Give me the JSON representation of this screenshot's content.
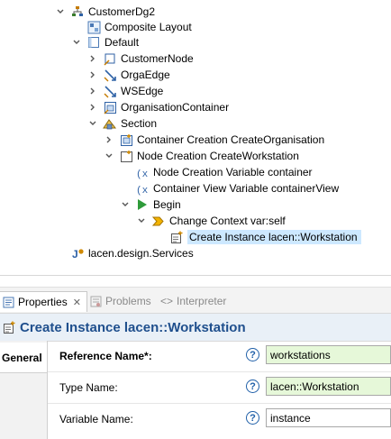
{
  "tree": {
    "items": [
      {
        "label": "CustomerDg2",
        "icon": "diagram-tree-icon"
      },
      {
        "label": "Composite Layout",
        "icon": "layout-icon"
      },
      {
        "label": "Default",
        "icon": "layer-icon"
      },
      {
        "label": "CustomerNode",
        "icon": "node-icon"
      },
      {
        "label": "OrgaEdge",
        "icon": "edge-icon"
      },
      {
        "label": "WSEdge",
        "icon": "edge-icon"
      },
      {
        "label": "OrganisationContainer",
        "icon": "container-icon"
      },
      {
        "label": "Section",
        "icon": "section-icon"
      },
      {
        "label": "Container Creation CreateOrganisation",
        "icon": "container-creation-icon"
      },
      {
        "label": "Node Creation CreateWorkstation",
        "icon": "node-creation-icon"
      },
      {
        "label": "Node Creation Variable container",
        "icon": "variable-icon"
      },
      {
        "label": "Container View Variable containerView",
        "icon": "variable-icon"
      },
      {
        "label": "Begin",
        "icon": "begin-icon"
      },
      {
        "label": "Change Context var:self",
        "icon": "change-context-icon"
      },
      {
        "label": "Create Instance lacen::Workstation",
        "icon": "create-instance-icon"
      },
      {
        "label": "lacen.design.Services",
        "icon": "services-icon"
      }
    ]
  },
  "tabs": {
    "properties": "Properties",
    "problems": "Problems",
    "interpreter": "Interpreter"
  },
  "header": {
    "title": "Create Instance lacen::Workstation"
  },
  "sidebar": {
    "general": "General"
  },
  "form": {
    "reference_name_label": "Reference Name*:",
    "reference_name_value": "workstations",
    "type_name_label": "Type Name:",
    "type_name_value": "lacen::Workstation",
    "variable_name_label": "Variable Name:",
    "variable_name_value": "instance",
    "help_glyph": "?"
  },
  "colors": {
    "accent": "#1f4f8d",
    "selection": "#cde8ff",
    "valid_field": "#e6f8d9"
  }
}
